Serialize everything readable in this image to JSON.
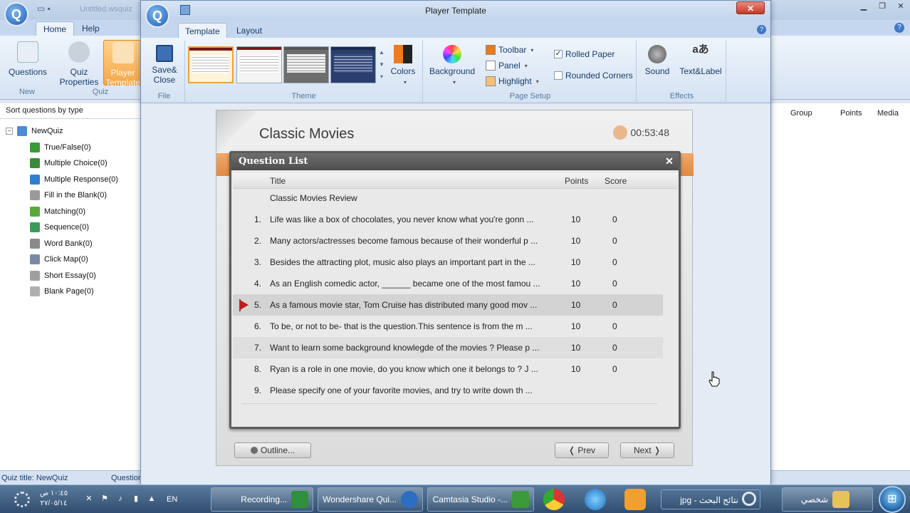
{
  "background_app": {
    "title": "Untitled.wsquiz",
    "tabs": [
      "Home",
      "Help"
    ],
    "ribbon": {
      "questions_label": "Questions",
      "quiz_properties_label": "Quiz Properties",
      "player_template_label": "Player Template",
      "group_new": "New",
      "group_quiz": "Quiz"
    },
    "sort_label": "Sort questions by type",
    "tree_root": "NewQuiz",
    "tree_items": [
      {
        "label": "True/False(0)",
        "color": "#3a9a3a"
      },
      {
        "label": "Multiple Choice(0)",
        "color": "#3a8a3a"
      },
      {
        "label": "Multiple Response(0)",
        "color": "#2f7fcf"
      },
      {
        "label": "Fill in the Blank(0)",
        "color": "#9a9a9a"
      },
      {
        "label": "Matching(0)",
        "color": "#5aa83a"
      },
      {
        "label": "Sequence(0)",
        "color": "#3a9a5a"
      },
      {
        "label": "Word Bank(0)",
        "color": "#8a8a8a"
      },
      {
        "label": "Click Map(0)",
        "color": "#7a8aa6"
      },
      {
        "label": "Short Essay(0)",
        "color": "#a0a0a0"
      },
      {
        "label": "Blank Page(0)",
        "color": "#b0b0b0"
      }
    ],
    "columns": [
      "Group",
      "Points",
      "Media"
    ],
    "status_quiz_title": "Quiz title: NewQuiz",
    "status_question": "Question"
  },
  "dialog": {
    "title": "Player Template",
    "tabs": [
      "Template",
      "Layout"
    ],
    "ribbon": {
      "save_close_label": "Save& Close",
      "file_group": "File",
      "theme_group": "Theme",
      "colors_label": "Colors",
      "background_label": "Background",
      "toolbar_label": "Toolbar",
      "panel_label": "Panel",
      "highlight_label": "Highlight",
      "rolled_paper_label": "Rolled Paper",
      "rolled_paper_checked": true,
      "rounded_corners_label": "Rounded Corners",
      "rounded_corners_checked": false,
      "page_setup_group": "Page Setup",
      "sound_label": "Sound",
      "text_label_label": "Text&Label",
      "effects_group": "Effects",
      "toolbar_color": "#e87a1e",
      "panel_color": "#ffffff",
      "highlight_color": "#f7c07a"
    },
    "player": {
      "quiz_title": "Classic Movies",
      "timer": "00:53:48",
      "panel_title": "Question List",
      "columns": {
        "title": "Title",
        "points": "Points",
        "score": "Score"
      },
      "section": "Classic Movies Review",
      "questions": [
        {
          "num": "1.",
          "title": "Life was like a box of chocolates, you never know what you're gonn ...",
          "points": "10",
          "score": "0"
        },
        {
          "num": "2.",
          "title": "Many actors/actresses become famous because of their wonderful p ...",
          "points": "10",
          "score": "0"
        },
        {
          "num": "3.",
          "title": "Besides the attracting plot, music also plays an important part in the ...",
          "points": "10",
          "score": "0"
        },
        {
          "num": "4.",
          "title": "As an English comedic actor, ______ became one of the most famou ...",
          "points": "10",
          "score": "0"
        },
        {
          "num": "5.",
          "title": "As a famous movie star, Tom Cruise has distributed many good mov ...",
          "points": "10",
          "score": "0"
        },
        {
          "num": "6.",
          "title": "To be, or not to be- that is the question.This sentence is from the m ...",
          "points": "10",
          "score": "0"
        },
        {
          "num": "7.",
          "title": "Want to learn some background knowlegde of the movies ? Please p ...",
          "points": "10",
          "score": "0"
        },
        {
          "num": "8.",
          "title": "Ryan is a role in one movie, do you know which one it belongs to ? J ...",
          "points": "10",
          "score": "0"
        },
        {
          "num": "9.",
          "title": "Please specify one of your favorite movies, and try to write down th ...",
          "points": "",
          "score": ""
        }
      ],
      "outline_label": "Outline...",
      "prev_label": "❬ Prev",
      "next_label": "Next ❭"
    }
  },
  "taskbar": {
    "clock_time": "١٠:٤٥ ص",
    "clock_date": "٢٧/٠٥/١٤",
    "lang": "EN",
    "buttons": [
      "Recording...",
      "Wondershare Qui...",
      "Camtasia Studio -...",
      "jpg - نتائج البحث"
    ],
    "search_text": "شخصي"
  }
}
